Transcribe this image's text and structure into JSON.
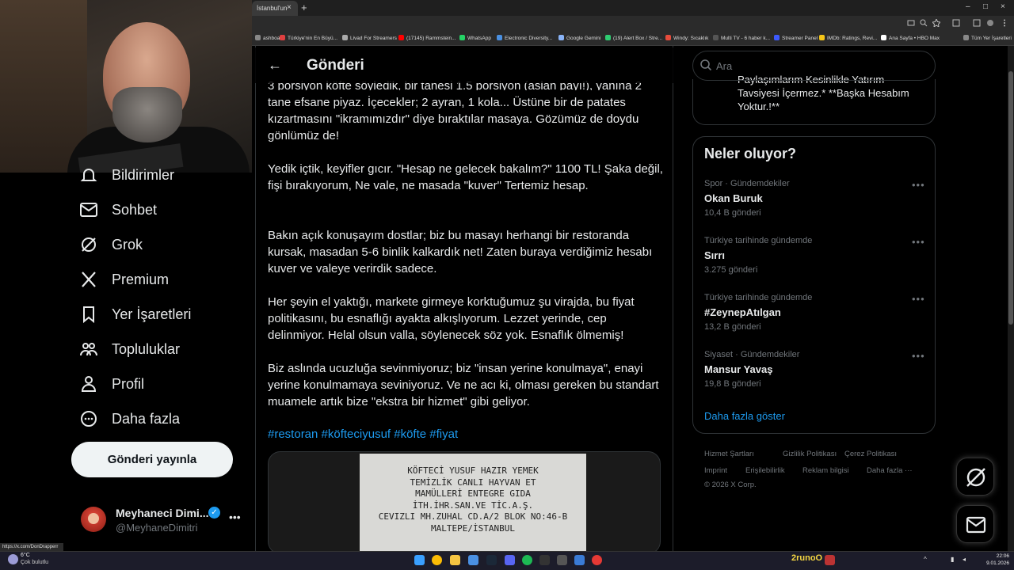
{
  "browser": {
    "tab_title": "İstanbul'un",
    "tab_close": "×",
    "new_tab": "+",
    "window_controls": [
      "–",
      "□",
      "×"
    ],
    "bookmarks": [
      {
        "label": "ashboard",
        "color": "#888"
      },
      {
        "label": "Türkiye'nin En Büyü...",
        "color": "#e04040"
      },
      {
        "label": "Livad For Streamers",
        "color": "#aaaaaa"
      },
      {
        "label": "(17145) Rammstein...",
        "color": "#ff0000"
      },
      {
        "label": "WhatsApp",
        "color": "#25d366"
      },
      {
        "label": "Electronic Diversity...",
        "color": "#4a90e2"
      },
      {
        "label": "Google Gemini",
        "color": "#8ab4f8"
      },
      {
        "label": "(19) Alert Box / Stre...",
        "color": "#2ecc71"
      },
      {
        "label": "Windy: Sıcaklık",
        "color": "#e74c3c"
      },
      {
        "label": "Multi TV - 6 haber k...",
        "color": "#555"
      },
      {
        "label": "Streamer Panel",
        "color": "#3d5afe"
      },
      {
        "label": "IMDb: Ratings, Revi...",
        "color": "#f5c518"
      },
      {
        "label": "Ana Sayfa • HBO Max",
        "color": "#ffffff"
      },
      {
        "label": "Tüm Yer İşaretleri",
        "color": "#888"
      }
    ]
  },
  "sidebar": {
    "items": [
      {
        "label": "Bildirimler",
        "icon": "bell-icon"
      },
      {
        "label": "Sohbet",
        "icon": "mail-icon"
      },
      {
        "label": "Grok",
        "icon": "grok-icon"
      },
      {
        "label": "Premium",
        "icon": "x-logo-icon"
      },
      {
        "label": "Yer İşaretleri",
        "icon": "bookmark-icon"
      },
      {
        "label": "Topluluklar",
        "icon": "people-icon"
      },
      {
        "label": "Profil",
        "icon": "person-icon"
      },
      {
        "label": "Daha fazla",
        "icon": "more-circle-icon"
      }
    ],
    "post_button": "Gönderi yayınla",
    "account": {
      "name": "Meyhaneci Dimi...",
      "handle": "@MeyhaneDimitri",
      "more": "•••"
    },
    "status_url": "https://x.com/DonDrapperr"
  },
  "main": {
    "back": "←",
    "title": "Gönderi",
    "cut_line": "3 porsiyon köfte söyledik, bir tanesi 1.5 porsiyon (aslan payı!), yanına 2",
    "paragraphs": [
      "tane efsane piyaz. İçecekler; 2 ayran, 1 kola... Üstüne bir de patates kızartmasını \"ikramımızdır\" diye bıraktılar masaya. Gözümüz de doydu gönlümüz de!",
      "Yedik içtik, keyifler gıcır. \"Hesap ne gelecek bakalım?\" 1100 TL! Şaka değil, fişi bırakıyorum, Ne vale, ne masada \"kuver\" Tertemiz hesap.",
      "Bakın açık konuşayım dostlar; biz bu masayı herhangi bir restoranda kursak, masadan 5-6 binlik kalkardık net! Zaten buraya verdiğimiz hesabı kuver ve valeye verirdik sadece.",
      "Her şeyin el yaktığı, markete girmeye korktuğumuz şu virajda, bu fiyat politikasını, bu esnaflığı ayakta alkışlıyorum. Lezzet yerinde, cep delinmiyor. Helal olsun valla, söylenecek söz yok. Esnaflık ölmemiş!",
      "Biz aslında ucuzluğa sevinmiyoruz; biz \"insan yerine konulmaya\", enayi yerine konulmamaya seviniyoruz. Ve ne acı ki, olması gereken bu standart muamele artık bize \"ekstra bir hizmet\" gibi geliyor."
    ],
    "hashtags": "#restoran #köfteciyusuf #köfte #fiyat",
    "receipt_lines": [
      "KÖFTECİ YUSUF HAZIR YEMEK",
      "TEMİZLİK CANLI HAYVAN ET",
      "MAMÜLLERİ ENTEGRE GIDA",
      "İTH.İHR.SAN.VE TİC.A.Ş.",
      "CEVIZLI MH.ZUHAL CD.A/2 BLOK NO:46-B",
      "MALTEPE/İSTANBUL"
    ]
  },
  "right": {
    "search_placeholder": "Ara",
    "top_card_text": "Paylaşımlarım Kesinlikle Yatırım Tavsiyesi İçermez.* **Başka Hesabım Yoktur.!**",
    "trends_title": "Neler oluyor?",
    "trends": [
      {
        "meta": "Spor · Gündemdekiler",
        "name": "Okan Buruk",
        "count": "10,4 B gönderi"
      },
      {
        "meta": "Türkiye tarihinde gündemde",
        "name": "Sırrı",
        "count": "3.275 gönderi"
      },
      {
        "meta": "Türkiye tarihinde gündemde",
        "name": "#ZeynepAtılgan",
        "count": "13,2 B gönderi"
      },
      {
        "meta": "Siyaset · Gündemdekiler",
        "name": "Mansur Yavaş",
        "count": "19,8 B gönderi"
      }
    ],
    "trend_more": "•••",
    "show_more": "Daha fazla göster",
    "footer": {
      "terms": "Hizmet Şartları",
      "privacy": "Gizlilik Politikası",
      "cookies": "Çerez Politikası",
      "imprint": "Imprint",
      "accessibility": "Erişilebilirlik",
      "ads": "Reklam bilgisi",
      "more": "Daha fazla ···",
      "copyright": "© 2026 X Corp."
    }
  },
  "taskbar": {
    "temp": "6°C",
    "weather": "Çok bulutlu",
    "user": "2runoO",
    "time": "22:06",
    "date": "9.01.2026"
  }
}
